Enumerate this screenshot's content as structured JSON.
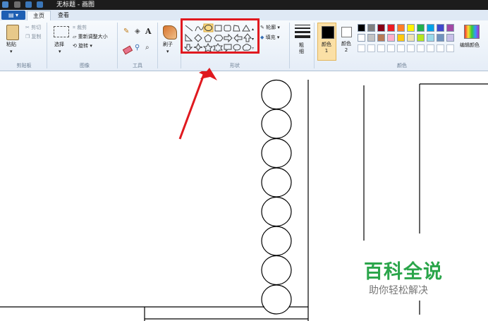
{
  "window": {
    "title": "无标题 - 画图"
  },
  "tabs": {
    "file": "▤ ▾",
    "home": "主页",
    "view": "查看"
  },
  "clipboard": {
    "paste": "粘贴",
    "cut": "剪切",
    "copy": "复制",
    "label": "剪贴板"
  },
  "image": {
    "select": "选择",
    "crop": "裁剪",
    "resize": "重新调整大小",
    "rotate": "旋转 ▾",
    "label": "图像"
  },
  "tools": {
    "label": "工具",
    "text_glyph": "A"
  },
  "brushes": {
    "label": "刷子"
  },
  "shapes": {
    "outline": "轮廓 ▾",
    "fill": "填充 ▾",
    "label": "形状"
  },
  "size": {
    "label": "粗细"
  },
  "colors": {
    "color1": "颜色 1",
    "color2": "颜色 2",
    "edit": "编辑颜色",
    "label": "颜色",
    "color1_value": "#000000",
    "color2_value": "#ffffff",
    "palette_row1": [
      "#000000",
      "#7f7f7f",
      "#880015",
      "#ed1c24",
      "#ff7f27",
      "#fff200",
      "#22b14c",
      "#00a2e8",
      "#3f48cc",
      "#a349a4"
    ],
    "palette_row2": [
      "#ffffff",
      "#c3c3c3",
      "#b97a57",
      "#ffaec9",
      "#ffc90e",
      "#efe4b0",
      "#b5e61d",
      "#99d9ea",
      "#7092be",
      "#c8bfe7"
    ]
  },
  "watermark": {
    "title": "百科全说",
    "subtitle": "助你轻松解决"
  },
  "annotation": {
    "highlight_color": "#e0191f"
  }
}
